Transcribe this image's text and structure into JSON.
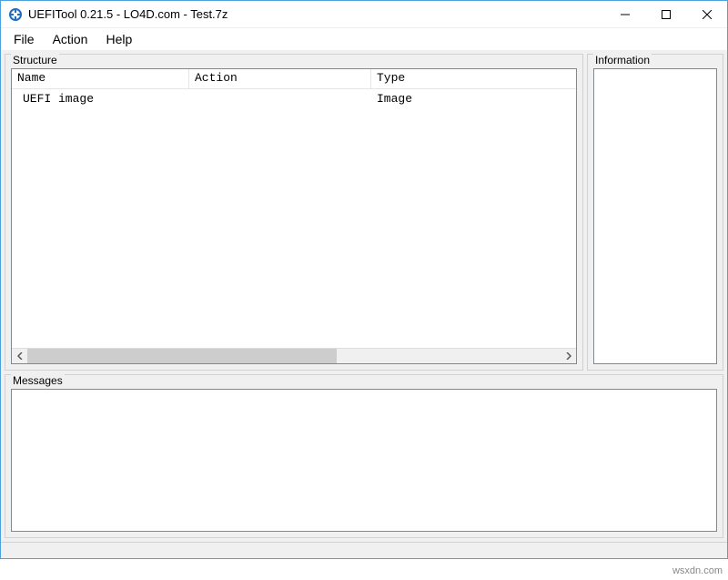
{
  "window": {
    "title": "UEFITool 0.21.5 - LO4D.com - Test.7z"
  },
  "menu": {
    "file": "File",
    "action": "Action",
    "help": "Help"
  },
  "panels": {
    "structure": "Structure",
    "information": "Information",
    "messages": "Messages"
  },
  "tree": {
    "headers": {
      "name": "Name",
      "action": "Action",
      "type": "Type"
    },
    "rows": [
      {
        "name": "UEFI image",
        "action": "",
        "type": "Image"
      }
    ]
  },
  "watermark": "wsxdn.com"
}
